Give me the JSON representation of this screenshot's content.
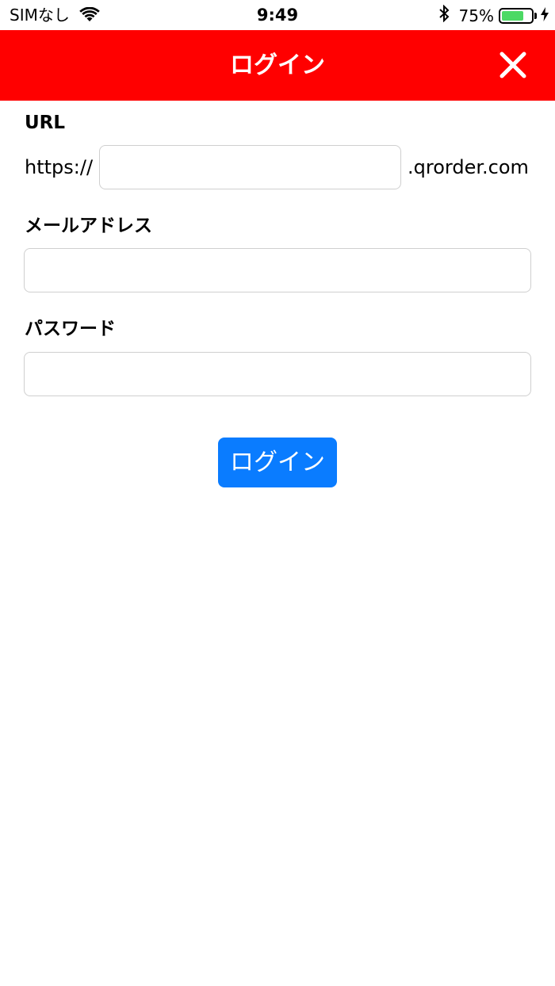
{
  "status_bar": {
    "carrier": "SIMなし",
    "time": "9:49",
    "battery_text": "75%",
    "battery_level": 0.75,
    "battery_color": "#4cd964"
  },
  "header": {
    "title": "ログイン",
    "close_icon": "close-x-icon",
    "background": "#ff0000"
  },
  "form": {
    "url_label": "URL",
    "url_prefix": "https://",
    "url_value": "",
    "url_suffix": ".qrorder.com",
    "email_label": "メールアドレス",
    "email_value": "",
    "password_label": "パスワード",
    "password_value": "",
    "submit_label": "ログイン",
    "submit_color": "#0a7cff"
  }
}
